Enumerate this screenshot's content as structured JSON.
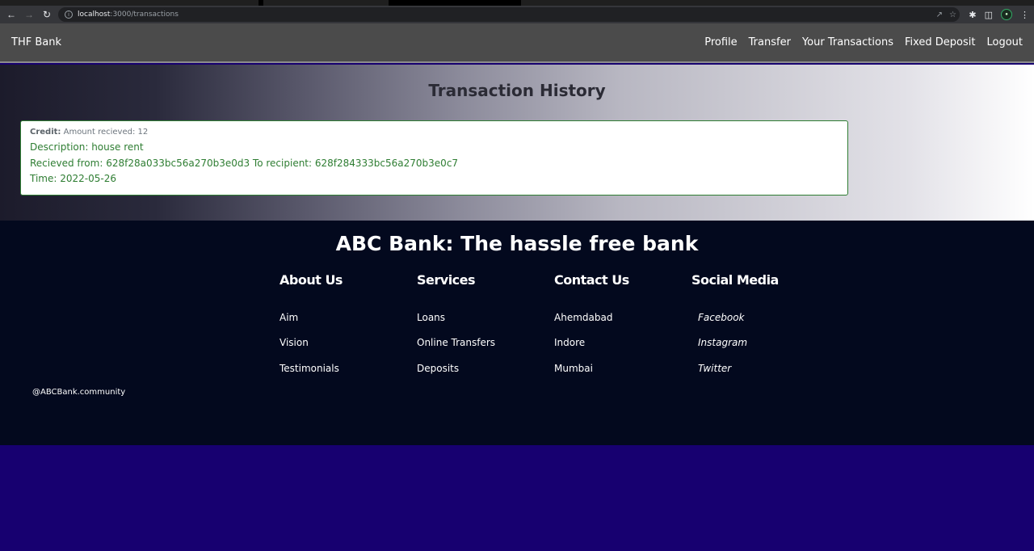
{
  "browser": {
    "url_host": "localhost",
    "url_rest": ":3000/transactions"
  },
  "navbar": {
    "brand": "THF Bank",
    "links": [
      "Profile",
      "Transfer",
      "Your Transactions",
      "Fixed Deposit",
      "Logout"
    ]
  },
  "main": {
    "title": "Transaction History",
    "transaction": {
      "type_label": "Credit:",
      "amount_text": "Amount recieved: 12",
      "description": "Description: house rent",
      "route": "Recieved from: 628f28a033bc56a270b3e0d3 To recipient: 628f284333bc56a270b3e0c7",
      "time": "Time: 2022-05-26"
    }
  },
  "footer": {
    "title": "ABC Bank: The hassle free bank",
    "columns": [
      {
        "heading": "About Us",
        "links": [
          "Aim",
          "Vision",
          "Testimonials"
        ]
      },
      {
        "heading": "Services",
        "links": [
          "Loans",
          "Online Transfers",
          "Deposits"
        ]
      },
      {
        "heading": "Contact Us",
        "links": [
          "Ahemdabad",
          "Indore",
          "Mumbai"
        ]
      },
      {
        "heading": "Social Media",
        "links": [
          "Facebook",
          "Instagram",
          "Twitter"
        ]
      }
    ],
    "handle": "@ABCBank.community"
  },
  "colors": {
    "navbar": "#4b4b4b",
    "footer": "#03091e",
    "page_bottom": "#170070",
    "transaction_text": "#2e7d32"
  }
}
